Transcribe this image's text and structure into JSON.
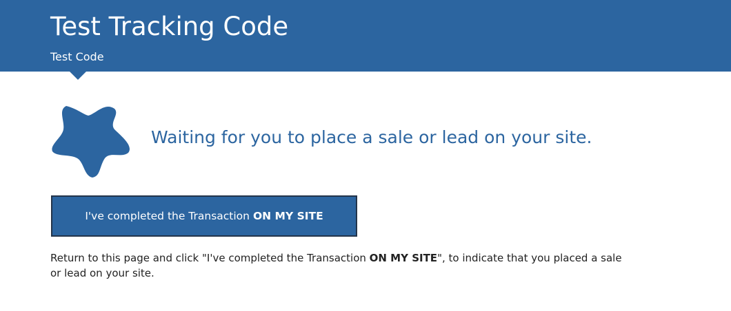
{
  "header": {
    "title": "Test Tracking Code",
    "tab_label": "Test Code",
    "background_color": "#2c65a0"
  },
  "status": {
    "icon": "star-icon",
    "icon_color": "#2c65a0",
    "message": "Waiting for you to place a sale or lead on your site."
  },
  "confirm_button": {
    "label_prefix": "I've completed the Transaction",
    "label_emphasis": "ON MY SITE",
    "background_color": "#2c65a0",
    "border_color": "#23344a"
  },
  "instructions": {
    "text_before": "Return to this page and click \"I've completed the Transaction ",
    "text_emphasis": "ON MY SITE",
    "text_after": "\", to indicate that you placed a sale or lead on your site."
  }
}
